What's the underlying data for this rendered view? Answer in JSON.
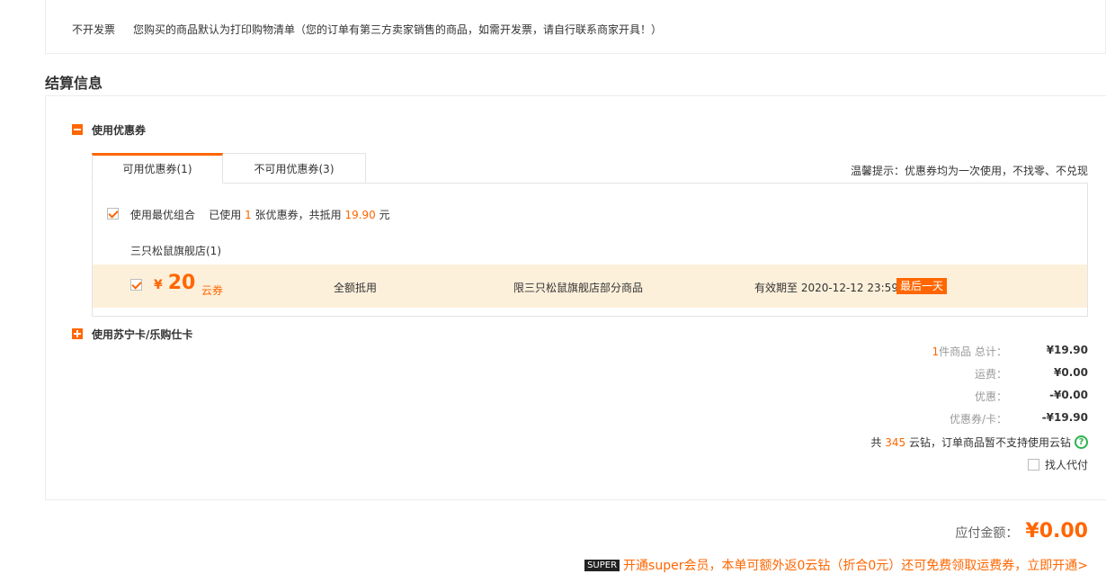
{
  "invoice": {
    "type": "不开发票",
    "note": "您购买的商品默认为打印购物清单（您的订单有第三方卖家销售的商品，如需开发票，请自行联系商家开具！）"
  },
  "section_title": "结算信息",
  "coupon_section": {
    "label": "使用优惠券",
    "tabs": [
      {
        "label": "可用优惠券(1)",
        "active": true
      },
      {
        "label": "不可用优惠券(3)",
        "active": false
      }
    ],
    "tip": "温馨提示：优惠券均为一次使用，不找零、不兑现",
    "best_combo": {
      "label": "使用最优组合",
      "used_prefix": "已使用",
      "used_count": "1",
      "used_mid": "张优惠券，共抵用",
      "used_amount": "19.90",
      "used_suffix": "元",
      "checked": true
    },
    "store": "三只松鼠旗舰店(1)",
    "coupon": {
      "checked": true,
      "currency": "¥",
      "amount": "20",
      "type": "云券",
      "usage": "全额抵用",
      "scope": "限三只松鼠旗舰店部分商品",
      "expire": "有效期至 2020-12-12 23:59",
      "badge": "最后一天"
    }
  },
  "card_section": {
    "label": "使用苏宁卡/乐购仕卡"
  },
  "summary": {
    "items_count": "1",
    "items_label": "件商品 总计：",
    "total": "¥19.90",
    "shipping_label": "运费：",
    "shipping": "¥0.00",
    "discount_label": "优惠：",
    "discount": "-¥0.00",
    "coupon_label": "优惠券/卡：",
    "coupon": "-¥19.90"
  },
  "yunzuan": {
    "prefix": "共",
    "count": "345",
    "suffix": "云钻，订单商品暂不支持使用云钻",
    "help": "?"
  },
  "proxy_pay": {
    "label": "找人代付"
  },
  "payable": {
    "label": "应付金额：",
    "value": "¥0.00"
  },
  "super_promo": {
    "badge": "SUPER",
    "text": "开通super会员，本单可额外返0云钻（折合0元）还可免费领取运费券，立即开通>"
  },
  "colors": {
    "accent": "#ff6600",
    "highlight_row": "#fdf0db",
    "help_icon": "#2bb24c"
  }
}
